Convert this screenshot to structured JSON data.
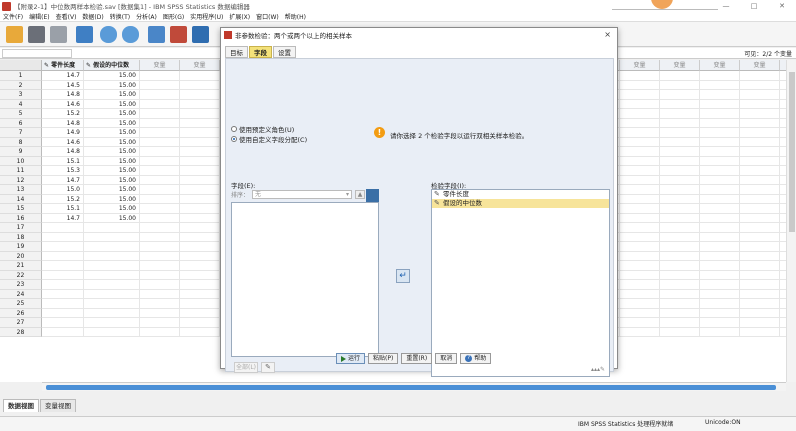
{
  "window": {
    "title": "【附录2-1】中位数两样本检验.sav [数据集1] - IBM SPSS Statistics 数据编辑器",
    "controls": [
      "—",
      "□",
      "✕"
    ]
  },
  "menu": [
    "文件(F)",
    "编辑(E)",
    "查看(V)",
    "数据(D)",
    "转换(T)",
    "分析(A)",
    "图形(G)",
    "实用程序(U)",
    "扩展(X)",
    "窗口(W)",
    "帮助(H)"
  ],
  "toolbar_icons": [
    "open-icon",
    "save-icon",
    "print-icon",
    "dialog-recall-icon",
    "undo-icon",
    "redo-icon",
    "goto-case-icon",
    "goto-variable-icon",
    "variables-icon"
  ],
  "visible_count": "可见：2/2 个变量",
  "grid": {
    "columns": [
      {
        "label": "零件长度",
        "kind": "var"
      },
      {
        "label": "假设的中位数",
        "kind": "var"
      },
      {
        "label": "变量",
        "kind": "empty"
      },
      {
        "label": "变量",
        "kind": "empty"
      },
      {
        "label": "变量",
        "kind": "empty"
      },
      {
        "label": "变量",
        "kind": "empty"
      },
      {
        "label": "变量",
        "kind": "empty"
      },
      {
        "label": "变量",
        "kind": "empty"
      },
      {
        "label": "变量",
        "kind": "empty"
      },
      {
        "label": "变量",
        "kind": "empty"
      },
      {
        "label": "变量",
        "kind": "empty"
      },
      {
        "label": "变量",
        "kind": "empty"
      },
      {
        "label": "变量",
        "kind": "empty"
      },
      {
        "label": "变量",
        "kind": "empty"
      },
      {
        "label": "变量",
        "kind": "empty"
      },
      {
        "label": "变量",
        "kind": "empty"
      },
      {
        "label": "变量",
        "kind": "empty"
      },
      {
        "label": "变量",
        "kind": "empty"
      },
      {
        "label": "变量",
        "kind": "empty"
      }
    ],
    "row_numbers": [
      "1",
      "2",
      "3",
      "4",
      "5",
      "6",
      "7",
      "8",
      "9",
      "10",
      "11",
      "12",
      "13",
      "14",
      "15",
      "16",
      "17",
      "18",
      "19",
      "20",
      "21",
      "22",
      "23",
      "24",
      "25",
      "26",
      "27",
      "28"
    ],
    "data": [
      [
        "14.7",
        "15.00"
      ],
      [
        "14.5",
        "15.00"
      ],
      [
        "14.8",
        "15.00"
      ],
      [
        "14.6",
        "15.00"
      ],
      [
        "15.2",
        "15.00"
      ],
      [
        "14.8",
        "15.00"
      ],
      [
        "14.9",
        "15.00"
      ],
      [
        "14.6",
        "15.00"
      ],
      [
        "14.8",
        "15.00"
      ],
      [
        "15.1",
        "15.00"
      ],
      [
        "15.3",
        "15.00"
      ],
      [
        "14.7",
        "15.00"
      ],
      [
        "15.0",
        "15.00"
      ],
      [
        "15.2",
        "15.00"
      ],
      [
        "15.1",
        "15.00"
      ],
      [
        "14.7",
        "15.00"
      ]
    ]
  },
  "bottom_tabs": {
    "data_view": "数据视图",
    "variable_view": "变量视图"
  },
  "status": {
    "processor": "IBM SPSS Statistics 处理程序就绪",
    "unicode": "Unicode:ON"
  },
  "dialog": {
    "title": "非参数检验：两个或两个以上的相关样本",
    "close": "×",
    "tabs": [
      "目标",
      "字段",
      "设置"
    ],
    "active_tab": "字段",
    "radio_predefined": "使用预定义角色(U)",
    "radio_custom": "使用自定义字段分配(C)",
    "info_text": "请你选择 2 个检验字段以运行双相关样本检验。",
    "fields_label": "字段(E):",
    "sort_label": "排序：",
    "sort_value": "无",
    "all_button": "全部(L)",
    "test_fields_label": "检验字段(I):",
    "test_fields": [
      "零件长度",
      "假设的中位数"
    ],
    "selected_test_field": "假设的中位数",
    "buttons": {
      "run": "运行",
      "paste": "粘贴(P)",
      "reset": "重置(R)",
      "cancel": "取消",
      "help": "帮助"
    }
  }
}
